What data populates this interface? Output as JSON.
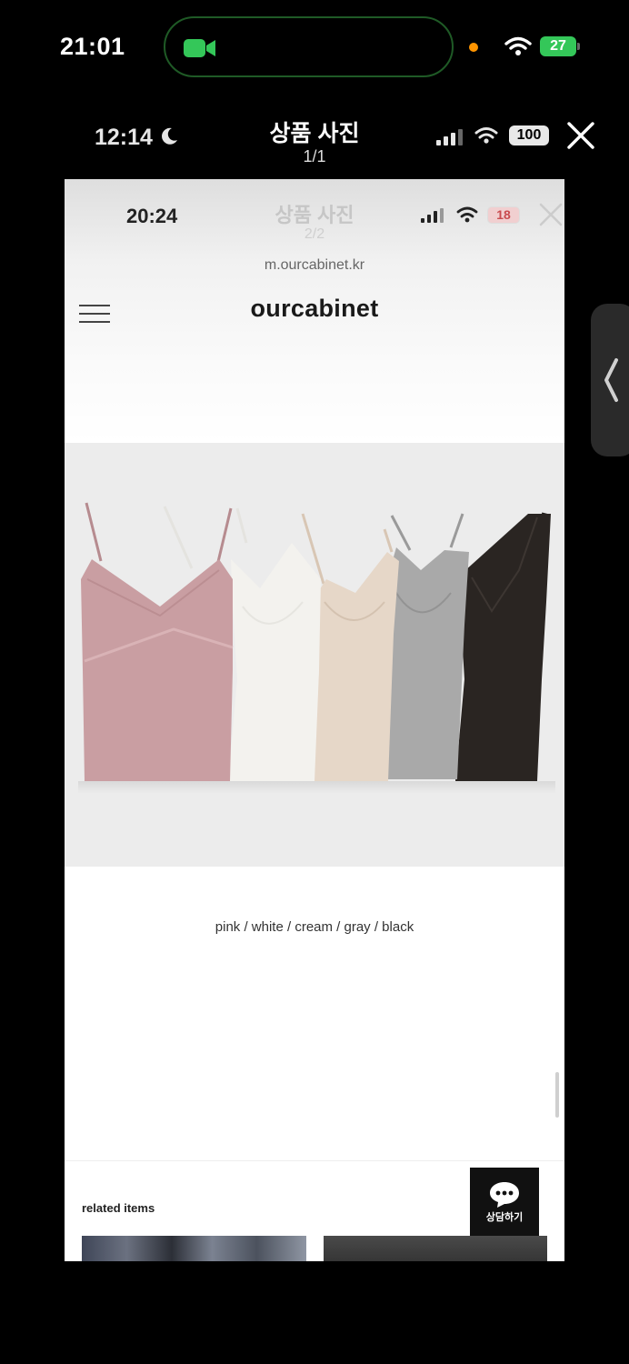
{
  "status_bar": {
    "time": "21:01",
    "battery": "27"
  },
  "viewer": {
    "time": "12:14",
    "title": "상품 사진",
    "count": "1/1",
    "battery": "100"
  },
  "screenshot": {
    "status": {
      "time": "20:24",
      "title": "상품 사진",
      "count": "2/2",
      "battery": "18"
    },
    "url": "m.ourcabinet.kr",
    "logo": "ourcabinet",
    "product_colors": [
      "pink",
      "white",
      "cream",
      "gray",
      "black"
    ],
    "caption": "pink / white / cream / gray / black",
    "related_title": "related items",
    "chat_label": "상담하기"
  },
  "colors": {
    "facetime_green": "#34c759",
    "island_ring": "#1f5a26",
    "recording_dot": "#ff9500",
    "pink": "#c99ea2",
    "white": "#f3f2ee",
    "cream": "#e6d7c8",
    "gray": "#a9a9a9",
    "black": "#2a2522"
  },
  "icons": [
    "facetime-video-icon",
    "wifi-icon",
    "battery-icon",
    "moon-icon",
    "signal-icon",
    "close-icon",
    "hamburger-menu-icon",
    "chat-bubble-icon",
    "chevron-left-icon"
  ]
}
